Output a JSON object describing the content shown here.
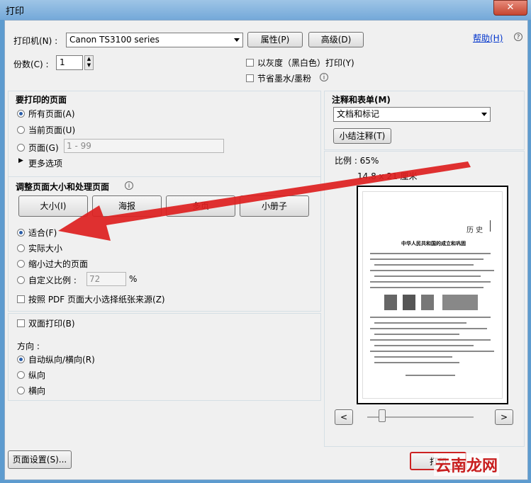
{
  "window": {
    "title": "打印",
    "close": "✕"
  },
  "printer": {
    "label": "打印机(N) :",
    "value": "Canon TS3100 series",
    "properties": "属性(P)",
    "advanced": "高级(D)"
  },
  "help": "帮助(H)",
  "copies": {
    "label": "份数(C) :",
    "value": "1"
  },
  "options": {
    "grayscale": "以灰度（黑白色）打印(Y)",
    "save_ink": "节省墨水/墨粉"
  },
  "pages": {
    "title": "要打印的页面",
    "all": "所有页面(A)",
    "current": "当前页面(U)",
    "range": "页面(G)",
    "range_placeholder": "1 - 99",
    "more": "更多选项"
  },
  "sizing": {
    "title": "调整页面大小和处理页面",
    "tabs": [
      "大小(I)",
      "海报",
      "多页",
      "小册子"
    ],
    "fit": "适合(F)",
    "actual": "实际大小",
    "shrink": "缩小过大的页面",
    "custom": "自定义比例 :",
    "custom_value": "72",
    "percent": "%",
    "paper_source": "按照 PDF 页面大小选择纸张来源(Z)"
  },
  "duplex": "双面打印(B)",
  "orientation": {
    "title": "方向 :",
    "auto": "自动纵向/横向(R)",
    "portrait": "纵向",
    "landscape": "横向"
  },
  "comments": {
    "title": "注释和表单(M)",
    "value": "文档和标记",
    "summarize": "小结注释(T)"
  },
  "preview": {
    "scale": "比例 : 65%",
    "size": "14.8 x 21 厘米",
    "prev": "<",
    "next": ">",
    "doc_header": "历 史",
    "doc_title": "中华人民共和国的成立和巩固"
  },
  "footer": {
    "page_setup": "页面设置(S)...",
    "print": "打印",
    "watermark": "云南龙网"
  }
}
